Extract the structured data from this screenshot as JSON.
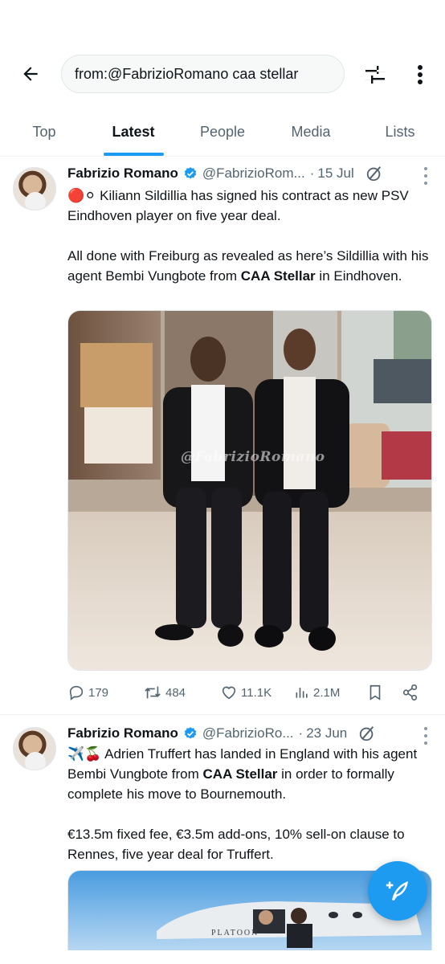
{
  "search": {
    "query": "from:@FabrizioRomano caa stellar"
  },
  "icons": {
    "back": "arrow-left-icon",
    "filter": "sliders-icon",
    "more": "vertical-dots-icon",
    "verified": "verified-badge-icon",
    "grok": "grok-icon",
    "reply": "reply-icon",
    "retweet": "retweet-icon",
    "like": "heart-icon",
    "views": "analytics-icon",
    "bookmark": "bookmark-icon",
    "share": "share-icon",
    "compose": "compose-feather-icon"
  },
  "colors": {
    "accent": "#1d9bf0",
    "text": "#0f1419",
    "muted": "#536471",
    "verified": "#1d9bf0"
  },
  "tabs": [
    {
      "label": "Top",
      "active": false
    },
    {
      "label": "Latest",
      "active": true
    },
    {
      "label": "People",
      "active": false
    },
    {
      "label": "Media",
      "active": false
    },
    {
      "label": "Lists",
      "active": false
    }
  ],
  "tweets": [
    {
      "name": "Fabrizio Romano",
      "handle": "@FabrizioRom...",
      "dot": "·",
      "date": "15 Jul",
      "lines": [
        {
          "emoji": "🔴⚪",
          "text": "Kiliann Sildillia has signed his contract as new PSV Eindhoven player on five year deal."
        },
        {
          "before": "All done with Freiburg as revealed as here’s Sildillia with his agent Bembi Vungbote from ",
          "bold": "CAA Stellar",
          "after": " in Eindhoven."
        }
      ],
      "media_watermark": "@FabrizioRomano",
      "stats": {
        "replies": "179",
        "retweets": "484",
        "likes": "11.1K",
        "views": "2.1M"
      }
    },
    {
      "name": "Fabrizio Romano",
      "handle": "@FabrizioRo...",
      "dot": "·",
      "date": "23 Jun",
      "lines": [
        {
          "emoji": "✈️🍒",
          "before": "Adrien Truffert has landed in England with his agent Bembi Vungbote from ",
          "bold": "CAA Stellar",
          "after": " in order to formally complete his move to Bournemouth."
        },
        {
          "text": "€13.5m fixed fee, €3.5m add-ons, 10% sell-on clause to Rennes, five year deal for Truffert."
        }
      ],
      "media_text": "PLATOON"
    }
  ]
}
